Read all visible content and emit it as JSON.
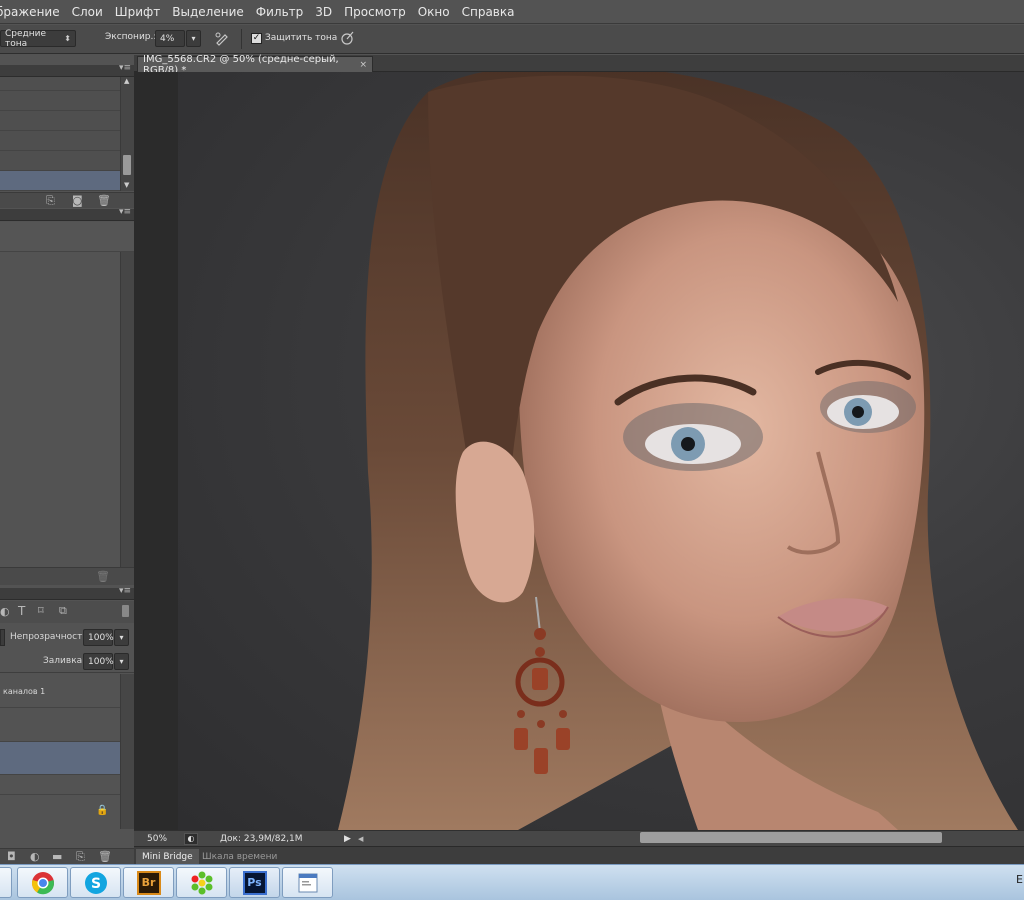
{
  "menu": [
    "бражение",
    "Слои",
    "Шрифт",
    "Выделение",
    "Фильтр",
    "3D",
    "Просмотр",
    "Окно",
    "Справка"
  ],
  "options": {
    "range_value": "Средние тона",
    "exposure_label": "Экспонир.:",
    "exposure_value": "4%",
    "protect_tones_label": "Защитить тона",
    "protect_tones_checked": true
  },
  "document": {
    "tab_title": "IMG_5568.CR2 @ 50% (средне-серый, RGB/8) *",
    "close_glyph": "×"
  },
  "status": {
    "zoom": "50%",
    "doc_info": "Док: 23,9M/82,1M"
  },
  "bottom_tabs": [
    "Mini Bridge",
    "Шкала времени"
  ],
  "layers_panel": {
    "opacity_label": "Непрозрачность:",
    "opacity_value": "100%",
    "fill_label": "Заливка:",
    "fill_value": "100%",
    "layer_partial_label": "каналов 1"
  },
  "taskbar": {
    "apps": [
      {
        "name": "chrome",
        "icon": "chrome-icon"
      },
      {
        "name": "skype",
        "icon": "skype-icon"
      },
      {
        "name": "bridge",
        "icon": "bridge-icon",
        "text": "Br"
      },
      {
        "name": "icq",
        "icon": "icq-icon"
      },
      {
        "name": "photoshop",
        "icon": "photoshop-icon",
        "text": "Ps"
      },
      {
        "name": "generic",
        "icon": "window-icon"
      }
    ],
    "edge_text": "E"
  },
  "colors": {
    "ui_bg": "#535353",
    "canvas_bg": "#2b2b2b",
    "selected_row": "#5e6a7f",
    "taskbar": "#bcd2e8",
    "ps_blue": "#1a2f6b",
    "br_orange": "#d98a1a"
  }
}
